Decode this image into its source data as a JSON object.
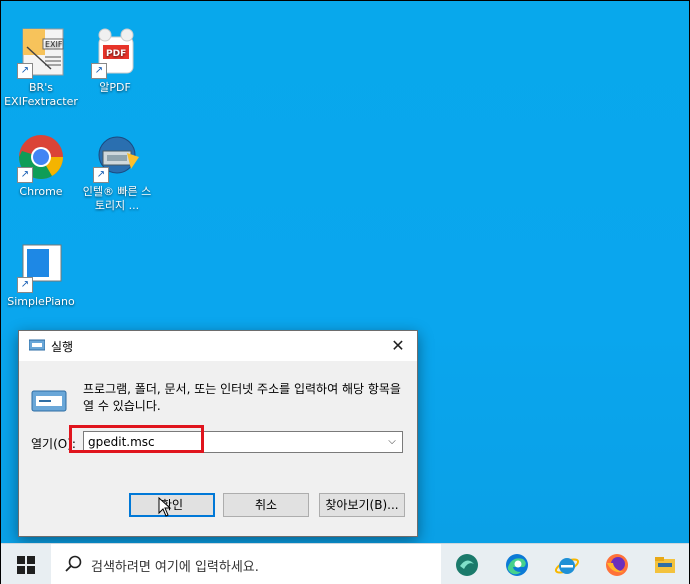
{
  "desktop": {
    "icons": [
      {
        "label": "BR's EXIFextracter",
        "badge": "EXIF"
      },
      {
        "label": "알PDF",
        "badge": "PDF"
      },
      {
        "label": "Chrome"
      },
      {
        "label": "인텔® 빠른 스토리지 ..."
      },
      {
        "label": "SimplePiano"
      }
    ]
  },
  "run_dialog": {
    "title": "실행",
    "description": "프로그램, 폴더, 문서, 또는 인터넷 주소를 입력하여 해당 항목을 열 수 있습니다.",
    "open_label": "열기(O):",
    "input_value": "gpedit.msc",
    "ok_label": "확인",
    "cancel_label": "취소",
    "browse_label": "찾아보기(B)...",
    "close_glyph": "✕",
    "dropdown_glyph": "⌵"
  },
  "taskbar": {
    "search_placeholder": "검색하려면 여기에 입력하세요.",
    "apps": [
      "app-icon",
      "edge-icon",
      "internet-explorer-icon",
      "firefox-icon",
      "file-explorer-icon"
    ]
  },
  "colors": {
    "desktop": "#0aa6ee",
    "highlight": "#e0141d",
    "accent": "#0078d7"
  }
}
